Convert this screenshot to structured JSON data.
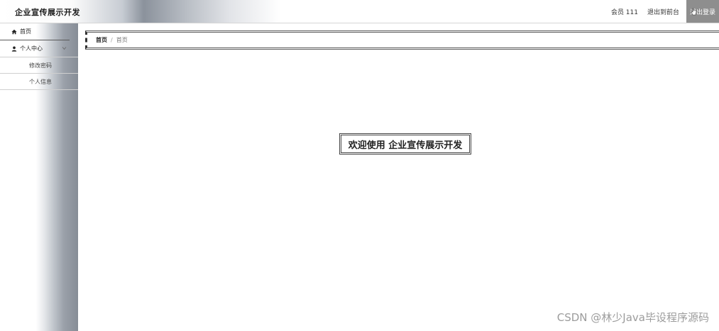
{
  "header": {
    "app_title": "企业宣传展示开发",
    "user_label": "会员 111",
    "back_to_front": "退出到前台",
    "logout": "退出登录"
  },
  "sidebar": {
    "items": [
      {
        "label": "首页",
        "icon": "home-icon"
      },
      {
        "label": "个人中心",
        "icon": "user-icon",
        "expanded": true,
        "children": [
          {
            "label": "修改密码"
          },
          {
            "label": "个人信息"
          }
        ]
      }
    ]
  },
  "breadcrumb": {
    "home": "首页",
    "separator": "/",
    "current": "首页"
  },
  "main": {
    "welcome_text": "欢迎使用 企业宣传展示开发"
  },
  "watermark": "CSDN @林少Java毕设程序源码",
  "colors": {
    "logout_bg": "#8e8e8e",
    "sidebar_dark": "#868d96"
  }
}
